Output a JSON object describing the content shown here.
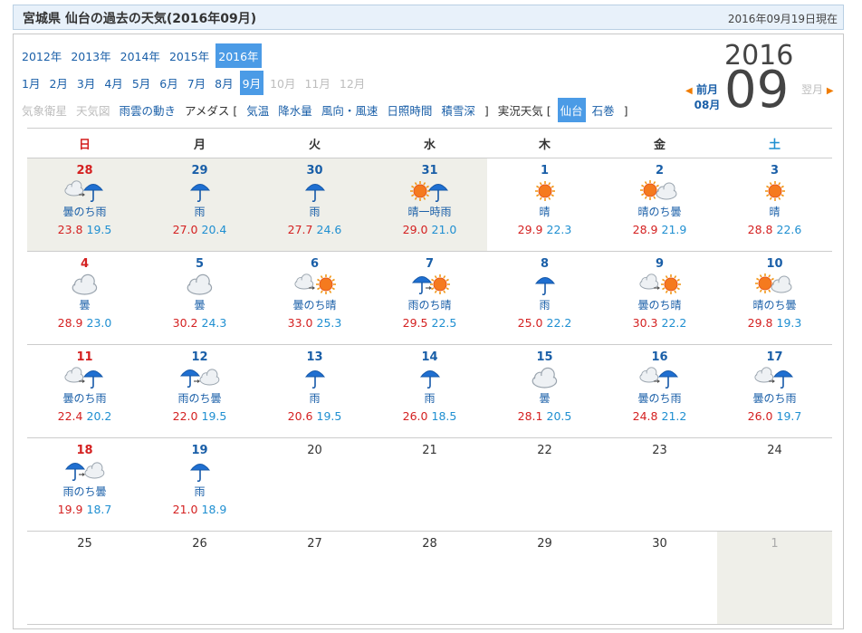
{
  "title": "宮城県 仙台の過去の天気(2016年09月)",
  "as_of": "2016年09月19日現在",
  "years": [
    {
      "label": "2012年",
      "state": "link"
    },
    {
      "label": "2013年",
      "state": "link"
    },
    {
      "label": "2014年",
      "state": "link"
    },
    {
      "label": "2015年",
      "state": "link"
    },
    {
      "label": "2016年",
      "state": "selected"
    }
  ],
  "months": [
    {
      "label": "1月",
      "state": "link"
    },
    {
      "label": "2月",
      "state": "link"
    },
    {
      "label": "3月",
      "state": "link"
    },
    {
      "label": "4月",
      "state": "link"
    },
    {
      "label": "5月",
      "state": "link"
    },
    {
      "label": "6月",
      "state": "link"
    },
    {
      "label": "7月",
      "state": "link"
    },
    {
      "label": "8月",
      "state": "link"
    },
    {
      "label": "9月",
      "state": "selected"
    },
    {
      "label": "10月",
      "state": "disabled"
    },
    {
      "label": "11月",
      "state": "disabled"
    },
    {
      "label": "12月",
      "state": "disabled"
    }
  ],
  "links": [
    {
      "label": "気象衛星",
      "state": "disabled"
    },
    {
      "label": "天気図",
      "state": "disabled"
    },
    {
      "label": "雨雲の動き",
      "state": "link"
    },
    {
      "label": "アメダス [",
      "state": "plain"
    },
    {
      "label": "気温",
      "state": "link"
    },
    {
      "label": "降水量",
      "state": "link"
    },
    {
      "label": "風向・風速",
      "state": "link"
    },
    {
      "label": "日照時間",
      "state": "link"
    },
    {
      "label": "積雪深",
      "state": "link"
    },
    {
      "label": "]",
      "state": "plain"
    },
    {
      "label": "実況天気 [",
      "state": "plain"
    },
    {
      "label": "仙台",
      "state": "selected"
    },
    {
      "label": "石巻",
      "state": "link"
    },
    {
      "label": "]",
      "state": "plain"
    }
  ],
  "header": {
    "year": "2016",
    "month": "09",
    "prev_label": "前月",
    "prev_month": "08月",
    "next_label": "翌月"
  },
  "weekdays": [
    "日",
    "月",
    "火",
    "水",
    "木",
    "金",
    "土"
  ],
  "weeks": [
    [
      {
        "day": "28",
        "icon": "cloud-then-rain",
        "weather": "曇のち雨",
        "hi": "23.8",
        "lo": "19.5",
        "gray": true
      },
      {
        "day": "29",
        "icon": "rain",
        "weather": "雨",
        "hi": "27.0",
        "lo": "20.4",
        "gray": true
      },
      {
        "day": "30",
        "icon": "rain",
        "weather": "雨",
        "hi": "27.7",
        "lo": "24.6",
        "gray": true
      },
      {
        "day": "31",
        "icon": "sun-sometimes-rain",
        "weather": "晴一時雨",
        "hi": "29.0",
        "lo": "21.0",
        "gray": true
      },
      {
        "day": "1",
        "icon": "sun",
        "weather": "晴",
        "hi": "29.9",
        "lo": "22.3"
      },
      {
        "day": "2",
        "icon": "sun-then-cloud",
        "weather": "晴のち曇",
        "hi": "28.9",
        "lo": "21.9"
      },
      {
        "day": "3",
        "icon": "sun",
        "weather": "晴",
        "hi": "28.8",
        "lo": "22.6"
      }
    ],
    [
      {
        "day": "4",
        "icon": "cloud",
        "weather": "曇",
        "hi": "28.9",
        "lo": "23.0"
      },
      {
        "day": "5",
        "icon": "cloud",
        "weather": "曇",
        "hi": "30.2",
        "lo": "24.3"
      },
      {
        "day": "6",
        "icon": "cloud-then-sun",
        "weather": "曇のち晴",
        "hi": "33.0",
        "lo": "25.3"
      },
      {
        "day": "7",
        "icon": "rain-then-sun",
        "weather": "雨のち晴",
        "hi": "29.5",
        "lo": "22.5"
      },
      {
        "day": "8",
        "icon": "rain",
        "weather": "雨",
        "hi": "25.0",
        "lo": "22.2"
      },
      {
        "day": "9",
        "icon": "cloud-then-sun",
        "weather": "曇のち晴",
        "hi": "30.3",
        "lo": "22.2"
      },
      {
        "day": "10",
        "icon": "sun-then-cloud",
        "weather": "晴のち曇",
        "hi": "29.8",
        "lo": "19.3"
      }
    ],
    [
      {
        "day": "11",
        "icon": "cloud-then-rain",
        "weather": "曇のち雨",
        "hi": "22.4",
        "lo": "20.2"
      },
      {
        "day": "12",
        "icon": "rain-then-cloud",
        "weather": "雨のち曇",
        "hi": "22.0",
        "lo": "19.5"
      },
      {
        "day": "13",
        "icon": "rain",
        "weather": "雨",
        "hi": "20.6",
        "lo": "19.5"
      },
      {
        "day": "14",
        "icon": "rain",
        "weather": "雨",
        "hi": "26.0",
        "lo": "18.5"
      },
      {
        "day": "15",
        "icon": "cloud",
        "weather": "曇",
        "hi": "28.1",
        "lo": "20.5"
      },
      {
        "day": "16",
        "icon": "cloud-then-rain",
        "weather": "曇のち雨",
        "hi": "24.8",
        "lo": "21.2"
      },
      {
        "day": "17",
        "icon": "cloud-then-rain",
        "weather": "曇のち雨",
        "hi": "26.0",
        "lo": "19.7"
      }
    ],
    [
      {
        "day": "18",
        "icon": "rain-then-cloud",
        "weather": "雨のち曇",
        "hi": "19.9",
        "lo": "18.7"
      },
      {
        "day": "19",
        "icon": "rain",
        "weather": "雨",
        "hi": "21.0",
        "lo": "18.9"
      },
      {
        "day": "20",
        "future": true
      },
      {
        "day": "21",
        "future": true
      },
      {
        "day": "22",
        "future": true
      },
      {
        "day": "23",
        "future": true
      },
      {
        "day": "24",
        "future": true
      }
    ],
    [
      {
        "day": "25",
        "future": true
      },
      {
        "day": "26",
        "future": true
      },
      {
        "day": "27",
        "future": true
      },
      {
        "day": "28",
        "future": true
      },
      {
        "day": "29",
        "future": true
      },
      {
        "day": "30",
        "future": true
      },
      {
        "day": "1",
        "future": true,
        "gray": true,
        "dim": true
      }
    ]
  ],
  "colors": {
    "sunday": "#d42020",
    "saturday": "#1f8fd1",
    "link": "#1a5fa8",
    "selected": "#4b9be6",
    "high_temp": "#d42020",
    "low_temp": "#1f8fd1",
    "past_cell": "#efefe9"
  }
}
